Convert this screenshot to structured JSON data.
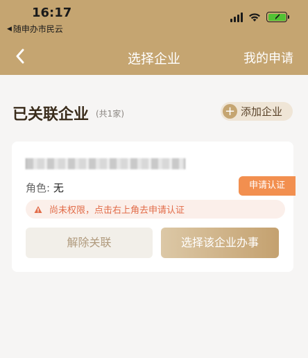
{
  "status_bar": {
    "time": "16:17",
    "back_app": "随申办市民云"
  },
  "nav": {
    "title": "选择企业",
    "right_action": "我的申请"
  },
  "section": {
    "title": "已关联企业",
    "count": "(共1家)",
    "add_button": "添加企业"
  },
  "card": {
    "company_name": "",
    "role_label": "角色:",
    "role_value": "无",
    "apply_tag": "申请认证",
    "notice": "尚未权限，点击右上角去申请认证",
    "unlink_button": "解除关联",
    "select_button": "选择该企业办事"
  },
  "colors": {
    "header": "#c5a571",
    "accent_orange": "#f28f4f",
    "notice_bg": "#fbefea",
    "notice_text": "#e26c49"
  }
}
